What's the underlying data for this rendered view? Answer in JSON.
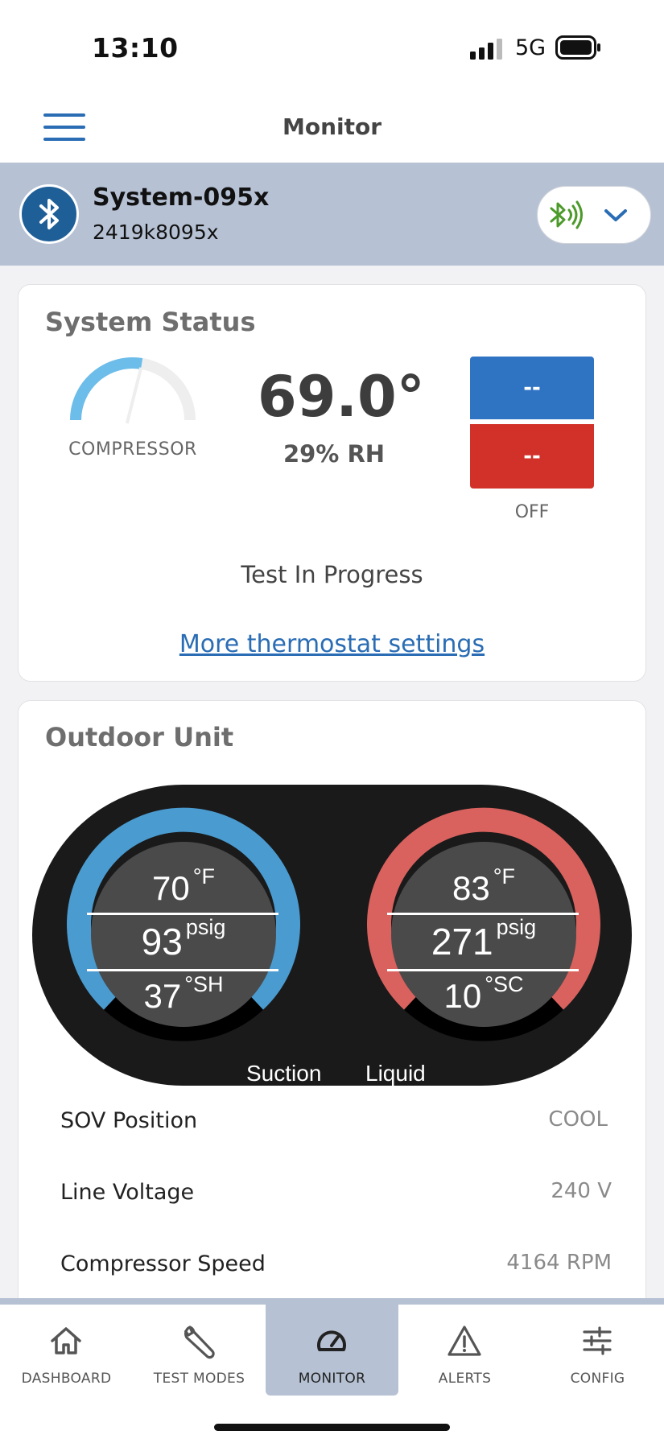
{
  "status_bar": {
    "time": "13:10",
    "carrier": "5G"
  },
  "nav": {
    "title": "Monitor"
  },
  "system": {
    "name": "System-095x",
    "serial": "2419k8095x"
  },
  "colors": {
    "accent": "#2a6db4",
    "cool": "#2e74c2",
    "heat": "#d13128",
    "suction_ring": "#4a9bd0",
    "liquid_ring": "#d9625e",
    "connected": "#4c9a2a"
  },
  "status_card": {
    "title": "System Status",
    "compressor_label": "COMPRESSOR",
    "compressor_level": 0.55,
    "temperature": "69.0°",
    "humidity": "29% RH",
    "cool_setpoint": "--",
    "heat_setpoint": "--",
    "mode": "OFF",
    "test_status": "Test In Progress",
    "settings_link": "More thermostat settings"
  },
  "outdoor_card": {
    "title": "Outdoor Unit",
    "suction": {
      "temp": "70",
      "temp_unit": "°F",
      "pressure": "93",
      "pressure_unit": "psig",
      "sh": "37",
      "sh_unit": "°SH",
      "caption": "Suction"
    },
    "liquid": {
      "temp": "83",
      "temp_unit": "°F",
      "pressure": "271",
      "pressure_unit": "psig",
      "sc": "10",
      "sc_unit": "°SC",
      "caption": "Liquid"
    },
    "rows": [
      {
        "label": "SOV Position",
        "value": "COOL"
      },
      {
        "label": "Line Voltage",
        "value": "240 V"
      },
      {
        "label": "Compressor Speed",
        "value": "4164 RPM"
      }
    ]
  },
  "tabs": [
    {
      "label": "DASHBOARD",
      "icon": "home-icon"
    },
    {
      "label": "TEST MODES",
      "icon": "wrench-icon"
    },
    {
      "label": "MONITOR",
      "icon": "gauge-icon",
      "active": true
    },
    {
      "label": "ALERTS",
      "icon": "warning-icon"
    },
    {
      "label": "CONFIG",
      "icon": "sliders-icon"
    }
  ]
}
